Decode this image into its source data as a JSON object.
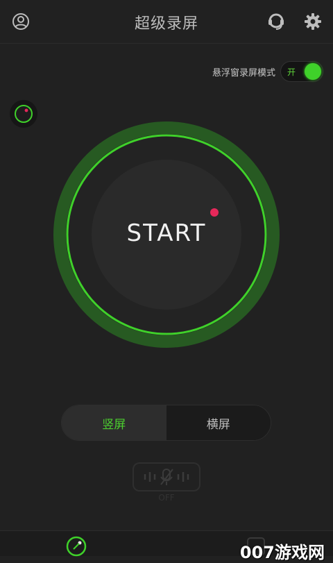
{
  "app": {
    "title": "超级录屏"
  },
  "floating_mode": {
    "label": "悬浮窗录屏模式",
    "toggle_text": "开",
    "enabled": true
  },
  "start_button": {
    "label": "START"
  },
  "orientation": {
    "options": [
      "竖屏",
      "横屏"
    ],
    "selected": "竖屏"
  },
  "mic": {
    "status_label": "OFF"
  },
  "watermark": {
    "text": "007游戏网"
  },
  "colors": {
    "accent": "#3fd12a",
    "record_dot": "#e5285a",
    "background": "#212121"
  },
  "icons": [
    "account-icon",
    "support-headset-icon",
    "settings-gear-icon",
    "floating-ball-icon",
    "mic-muted-icon",
    "record-tab-icon",
    "gallery-tab-icon"
  ]
}
